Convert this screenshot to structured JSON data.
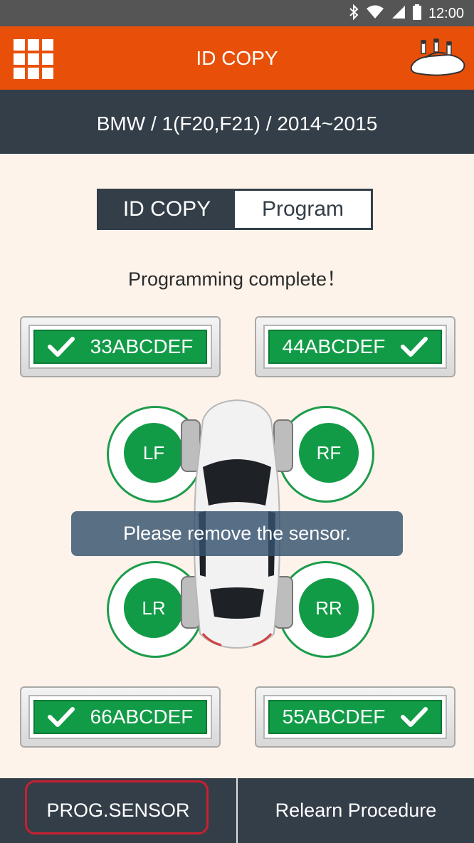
{
  "status_bar": {
    "time": "12:00",
    "icons": [
      "bluetooth-icon",
      "wifi-icon",
      "signal-icon",
      "battery-icon"
    ]
  },
  "app_bar": {
    "title": "ID COPY",
    "menu_icon": "grid-menu-icon",
    "brand_icon": "car-logo-icon"
  },
  "vehicle": {
    "label": "BMW / 1(F20,F21) / 2014~2015"
  },
  "mode_toggle": {
    "id_copy_label": "ID COPY",
    "program_label": "Program",
    "selected": "ID COPY"
  },
  "message": {
    "text": "Programming complete！"
  },
  "sensors": {
    "front_left": {
      "id": "33ABCDEF",
      "status": "ok"
    },
    "front_right": {
      "id": "44ABCDEF",
      "status": "ok"
    },
    "rear_left": {
      "id": "66ABCDEF",
      "status": "ok"
    },
    "rear_right": {
      "id": "55ABCDEF",
      "status": "ok"
    }
  },
  "wheels": {
    "lf": "LF",
    "rf": "RF",
    "lr": "LR",
    "rr": "RR"
  },
  "toast": {
    "text": "Please remove the sensor."
  },
  "bottom_bar": {
    "prog_sensor_label": "PROG.SENSOR",
    "relearn_label": "Relearn Procedure"
  },
  "colors": {
    "accent": "#e8500a",
    "dark": "#333e48",
    "success": "#129b47",
    "background": "#fdf3ea",
    "highlight": "#c8202f"
  }
}
